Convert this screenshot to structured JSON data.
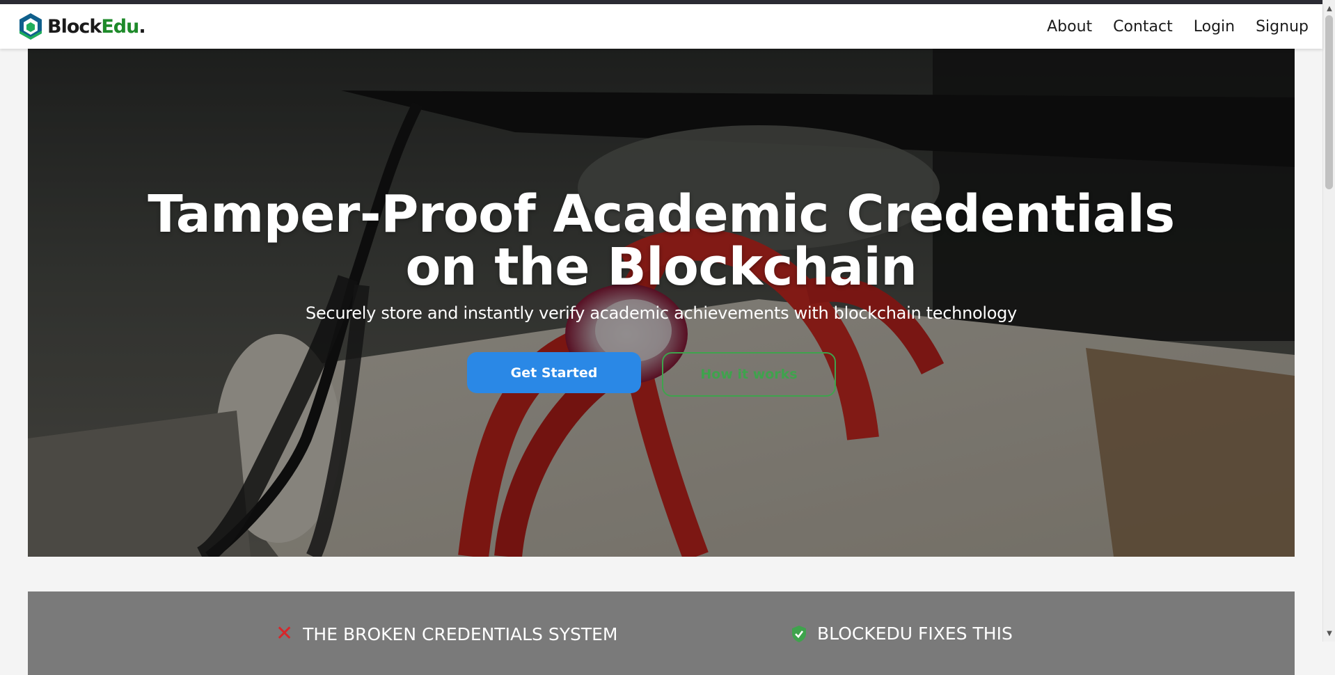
{
  "brand": {
    "name_part1": "Block",
    "name_part2": "Edu",
    "name_dot": ".",
    "logo_icon": "hexagon-cube-icon",
    "colors": {
      "block": "#1a1a1a",
      "edu": "#1e8a2a",
      "logo_dark": "#0f5f8c",
      "logo_green": "#1fae5b"
    }
  },
  "nav": {
    "items": [
      {
        "label": "About"
      },
      {
        "label": "Contact"
      },
      {
        "label": "Login"
      },
      {
        "label": "Signup"
      }
    ]
  },
  "hero": {
    "title": "Tamper-Proof Academic Credentials on the Blockchain",
    "subtitle": "Securely store and instantly verify academic achievements with blockchain technology",
    "primary_button": "Get Started",
    "secondary_button": "How it works",
    "colors": {
      "primary": "#2a88e6",
      "secondary": "#3fa34d"
    }
  },
  "problem": {
    "left_title": "THE BROKEN CREDENTIALS SYSTEM",
    "left_icon": "close-icon",
    "right_title": "BLOCKEDU FIXES THIS",
    "right_icon": "shield-check-icon",
    "colors": {
      "x": "#d8262a",
      "shield": "#3fa34d"
    }
  }
}
